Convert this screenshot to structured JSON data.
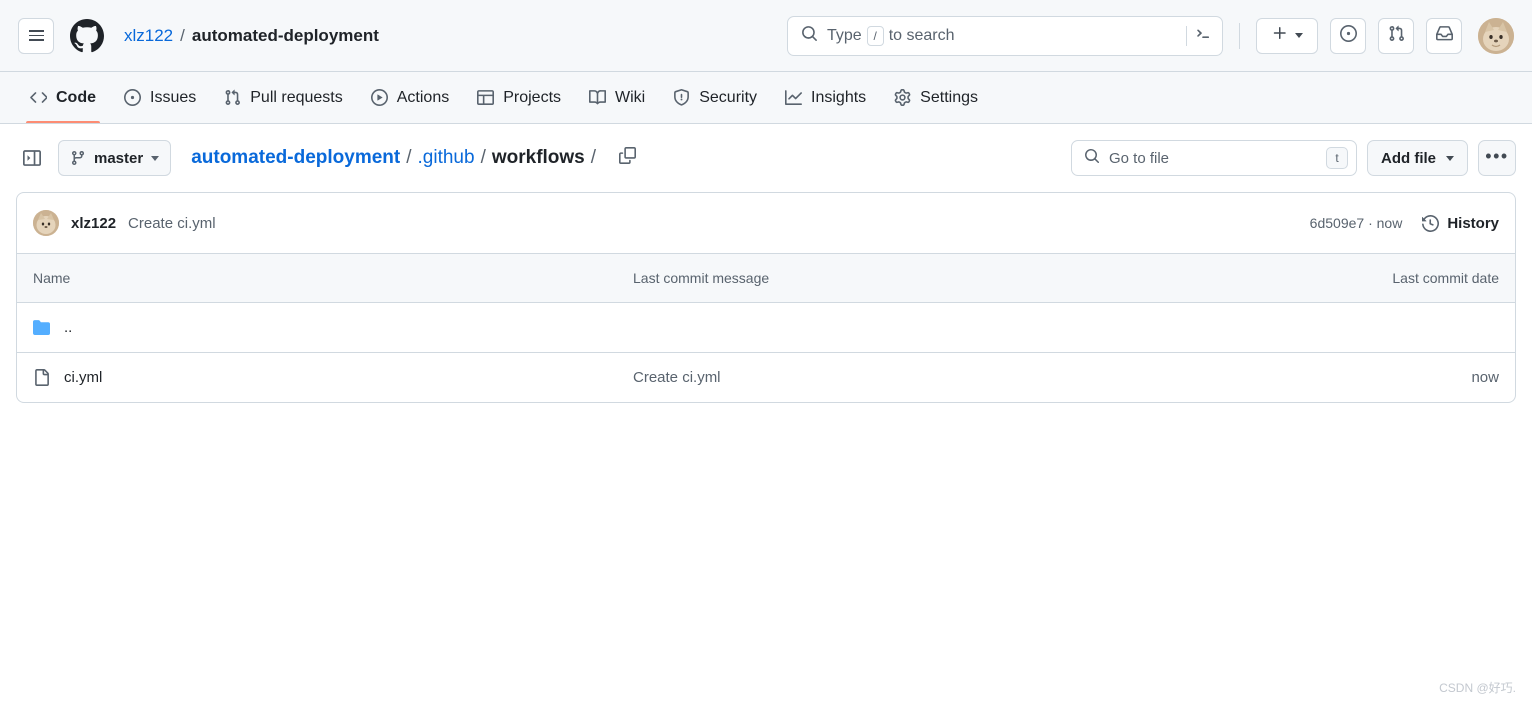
{
  "header": {
    "menu_icon": "hamburger-icon",
    "logo_icon": "github-mark-icon",
    "owner": "xlz122",
    "separator": "/",
    "repo": "automated-deployment",
    "search": {
      "icon": "search-icon",
      "prefix": "Type",
      "key": "/",
      "suffix": "to search",
      "terminal_icon": "command-palette-icon"
    },
    "create_button": {
      "icon": "plus-icon",
      "caret": "chevron-down-icon"
    },
    "issues_icon": "issue-opened-icon",
    "pulls_icon": "git-pull-request-icon",
    "inbox_icon": "inbox-icon",
    "avatar": "user-avatar"
  },
  "repo_nav": {
    "items": [
      {
        "label": "Code",
        "icon": "code-icon",
        "selected": true
      },
      {
        "label": "Issues",
        "icon": "issue-opened-icon",
        "selected": false
      },
      {
        "label": "Pull requests",
        "icon": "git-pull-request-icon",
        "selected": false
      },
      {
        "label": "Actions",
        "icon": "play-icon",
        "selected": false
      },
      {
        "label": "Projects",
        "icon": "table-icon",
        "selected": false
      },
      {
        "label": "Wiki",
        "icon": "book-icon",
        "selected": false
      },
      {
        "label": "Security",
        "icon": "shield-icon",
        "selected": false
      },
      {
        "label": "Insights",
        "icon": "graph-icon",
        "selected": false
      },
      {
        "label": "Settings",
        "icon": "gear-icon",
        "selected": false
      }
    ]
  },
  "path_row": {
    "sidebar_toggle_icon": "sidebar-expand-icon",
    "branch": {
      "icon": "git-branch-icon",
      "name": "master",
      "caret": "chevron-down-icon"
    },
    "breadcrumb": {
      "repo": "automated-deployment",
      "sep1": "/",
      "dir1": ".github",
      "sep2": "/",
      "current": "workflows",
      "sep3": "/"
    },
    "copy_path_icon": "copy-icon",
    "go_to_file": {
      "icon": "search-icon",
      "placeholder": "Go to file",
      "shortcut": "t"
    },
    "add_file": {
      "label": "Add file",
      "caret": "chevron-down-icon"
    },
    "more_button": "•••"
  },
  "commit_bar": {
    "avatar": "author-avatar",
    "author": "xlz122",
    "message": "Create ci.yml",
    "meta": "6d509e7 · now",
    "history_icon": "history-icon",
    "history_label": "History"
  },
  "file_table": {
    "columns": {
      "name": "Name",
      "message": "Last commit message",
      "date": "Last commit date"
    },
    "rows": [
      {
        "icon": "folder-icon",
        "type": "folder",
        "name": "..",
        "message": "",
        "date": ""
      },
      {
        "icon": "file-icon",
        "type": "file",
        "name": "ci.yml",
        "message": "Create ci.yml",
        "date": "now"
      }
    ]
  },
  "watermark": "CSDN @好巧.",
  "colors": {
    "accent": "#0969da",
    "active_tab_underline": "#fd8c73",
    "folder_blue": "#54aeff",
    "header_bg": "#f6f8fa",
    "border": "#d1d9e0",
    "muted_text": "#59636e"
  }
}
